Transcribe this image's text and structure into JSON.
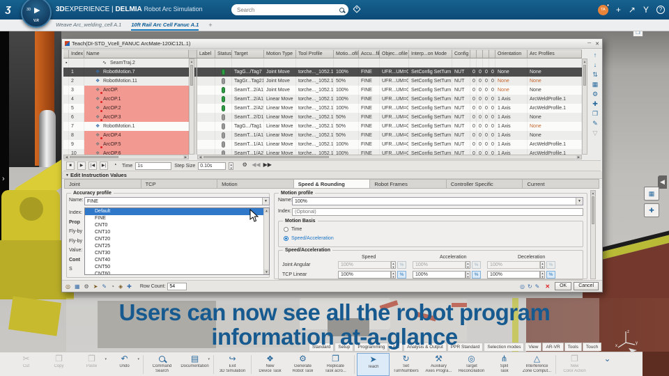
{
  "colors": {
    "topbar": "#0f4d7c",
    "accent_blue": "#1778bc",
    "caption_blue": "#175a8f",
    "selected_row": "#4d4d4d",
    "error_row_bg": "#f29a92",
    "warn_text": "#c4652c",
    "status_green": "#2f9e44",
    "status_gray": "#9a9a9a",
    "brown_floor": "#74392c",
    "robot_yellow": "#cfc12c"
  },
  "topbar": {
    "logo": "3S",
    "brand_3d": "3D",
    "brand_experience": "EXPERIENCE",
    "brand_divider": "|",
    "brand_app": "DELMIA",
    "brand_suffix": "Robot Arc Simulation",
    "compass": {
      "play": "▶",
      "label_3d": "3D",
      "version": "V.R"
    },
    "search_placeholder": "Search",
    "icons": {
      "avatar_initials": "TA",
      "add": "+",
      "share": "↗",
      "collab": "Y",
      "help": "?"
    }
  },
  "window_tabs": {
    "items": [
      {
        "label": "Weave Arc_welding_cell A.1",
        "active": false
      },
      {
        "label": "10ft Rail Arc Cell Fanuc A.1",
        "active": true
      }
    ],
    "add_label": "+"
  },
  "dialog": {
    "title": "Teach(DI-STD_Vcell_FANUC ArcMate-120iC12L.1)",
    "window_icons": [
      {
        "name": "float-icon",
        "glyph": "─"
      },
      {
        "name": "close-icon",
        "glyph": "✕"
      }
    ],
    "table": {
      "headers": {
        "marker": "",
        "index": "Index",
        "name": "Name",
        "gap": "",
        "label": "Label",
        "status": "Status",
        "target": "Target",
        "motion": "Motion Type",
        "tool": "Tool Profile",
        "profile": "Motio...ofile",
        "accuracy": "Accu...file",
        "object": "Objec...ofile",
        "interp": "Interp...on Mode",
        "config": "Config",
        "z0": "",
        "z1": "",
        "z2": "",
        "z3": "",
        "orientation": "Orientation",
        "arc": "Arc Profiles"
      },
      "rows": [
        {
          "kind": "traj",
          "marker": "▪",
          "index": "",
          "name": "SeamTraj.2",
          "status": "",
          "target": "",
          "motion": "",
          "tool": "",
          "profile": "",
          "accuracy": "",
          "object": "",
          "interp": "",
          "config": "",
          "zeros": [
            "",
            "",
            "",
            ""
          ],
          "orientation": "",
          "arc": ""
        },
        {
          "kind": "robot",
          "index": "1",
          "name": "RobotMotion.7",
          "selected": true,
          "status": "green",
          "target": "TagG.../Tag7",
          "motion": "Joint Move",
          "tool": "torche..._1052.1",
          "profile": "100%",
          "accuracy": "FINE",
          "object": "UFR...UM=0",
          "interp": "SetConfig SetTurn",
          "config": "NUT",
          "zeros": [
            "0",
            "0",
            "0",
            "0"
          ],
          "orientation": "None",
          "arc": "None"
        },
        {
          "kind": "robot",
          "index": "2",
          "name": "RobotMotion.11",
          "status": "gray",
          "target": "TagGr...Tag21",
          "motion": "Joint Move",
          "tool": "torche..._1052.1",
          "profile": "50%",
          "accuracy": "FINE",
          "object": "UFR...UM=0",
          "interp": "SetConfig SetTurn",
          "config": "NUT",
          "zeros": [
            "0",
            "0",
            "0",
            "0"
          ],
          "orientation": "None",
          "arc": "None",
          "orientation_warn": true,
          "arc_warn": true
        },
        {
          "kind": "arc",
          "index": "3",
          "name": "ArcOP.",
          "red": true,
          "status": "green",
          "target": "SeamT...2/A1",
          "motion": "Joint Move",
          "tool": "torche..._1052.1",
          "profile": "100%",
          "accuracy": "FINE",
          "object": "UFR...UM=0",
          "interp": "SetConfig SetTurn",
          "config": "NUT",
          "zeros": [
            "0",
            "0",
            "0",
            "0"
          ],
          "orientation": "None",
          "arc": "None",
          "orientation_warn": true
        },
        {
          "kind": "arc",
          "index": "4",
          "name": "ArcOP.1",
          "red": true,
          "status": "green",
          "target": "SeamT...2/A1",
          "motion": "Linear Move",
          "tool": "torche..._1052.1",
          "profile": "100%",
          "accuracy": "FINE",
          "object": "UFR...UM=0",
          "interp": "SetConfig SetTurn",
          "config": "NUT",
          "zeros": [
            "0",
            "0",
            "0",
            "0"
          ],
          "orientation": "1 Axis",
          "arc": "ArcWeldProfile.1"
        },
        {
          "kind": "arc",
          "index": "5",
          "name": "ArcOP.2",
          "red": true,
          "status": "green",
          "target": "SeamT...2/A2",
          "motion": "Linear Move",
          "tool": "torche..._1052.1",
          "profile": "100%",
          "accuracy": "FINE",
          "object": "UFR...UM=0",
          "interp": "SetConfig SetTurn",
          "config": "NUT",
          "zeros": [
            "0",
            "0",
            "0",
            "0"
          ],
          "orientation": "1 Axis",
          "arc": "ArcWeldProfile.1"
        },
        {
          "kind": "arc",
          "index": "6",
          "name": "ArcOP.3",
          "red": true,
          "status": "gray",
          "target": "SeamT...2/D1",
          "motion": "Linear Move",
          "tool": "torche..._1052.1",
          "profile": "50%",
          "accuracy": "FINE",
          "object": "UFR...UM=0",
          "interp": "SetConfig SetTurn",
          "config": "NUT",
          "zeros": [
            "0",
            "0",
            "0",
            "0"
          ],
          "orientation": "1 Axis",
          "arc": "None"
        },
        {
          "kind": "robot",
          "index": "7",
          "name": "RobotMotion.1",
          "status": "gray",
          "target": "TagG.../Tag1",
          "motion": "Linear Move",
          "tool": "torche..._1052.1",
          "profile": "50%",
          "accuracy": "FINE",
          "object": "UFR...UM=0",
          "interp": "SetConfig SetTurn",
          "config": "NUT",
          "zeros": [
            "0",
            "0",
            "0",
            "0"
          ],
          "orientation": "1 Axis",
          "arc": "None",
          "arc_warn": true
        },
        {
          "kind": "arc",
          "index": "8",
          "name": "ArcOP.4",
          "red": true,
          "status": "gray",
          "target": "SeamT...1/A1",
          "motion": "Linear Move",
          "tool": "torche..._1052.1",
          "profile": "50%",
          "accuracy": "FINE",
          "object": "UFR...UM=0",
          "interp": "SetConfig SetTurn",
          "config": "NUT",
          "zeros": [
            "0",
            "0",
            "0",
            "0"
          ],
          "orientation": "1 Axis",
          "arc": "None"
        },
        {
          "kind": "arc",
          "index": "9",
          "name": "ArcOP.5",
          "red": true,
          "status": "gray",
          "target": "SeamT...1/A1",
          "motion": "Linear Move",
          "tool": "torche..._1052.1",
          "profile": "100%",
          "accuracy": "FINE",
          "object": "UFR...UM=0",
          "interp": "SetConfig SetTurn",
          "config": "NUT",
          "zeros": [
            "0",
            "0",
            "0",
            "0"
          ],
          "orientation": "1 Axis",
          "arc": "ArcWeldProfile.1"
        },
        {
          "kind": "arc",
          "index": "10",
          "name": "ArcOP.6",
          "red": true,
          "status": "gray",
          "target": "SeamT...1/A2",
          "motion": "Linear Move",
          "tool": "torche..._1052.1",
          "profile": "100%",
          "accuracy": "FINE",
          "object": "UFR...UM=0",
          "interp": "SetConfig SetTurn",
          "config": "NUT",
          "zeros": [
            "0",
            "0",
            "0",
            "0"
          ],
          "orientation": "1 Axis",
          "arc": "ArcWeldProfile.1"
        }
      ]
    },
    "side_icons": [
      {
        "name": "move-row-up-icon",
        "glyph": "↑"
      },
      {
        "name": "move-row-down-icon",
        "glyph": "↓"
      },
      {
        "name": "swap-rows-icon",
        "glyph": "⇅"
      },
      {
        "name": "table-view-icon",
        "glyph": "▦"
      },
      {
        "name": "settings-icon",
        "glyph": "⚙"
      },
      {
        "name": "add-instruction-icon",
        "glyph": "✚"
      },
      {
        "name": "copy-row-icon",
        "glyph": "❐"
      },
      {
        "name": "edit-row-icon",
        "glyph": "✎"
      },
      {
        "name": "filter-icon",
        "glyph": "▽",
        "dim": true
      }
    ],
    "playback": {
      "buttons": [
        {
          "name": "stop-button",
          "glyph": "■"
        },
        {
          "name": "play-button",
          "glyph": "▶"
        },
        {
          "name": "skip-back-button",
          "glyph": "|◀"
        },
        {
          "name": "skip-forward-button",
          "glyph": "▶|"
        }
      ],
      "clock_icon": "◔",
      "time_label": "Time",
      "time_value": "1s",
      "step_label": "Step Size",
      "step_value": "0.10s",
      "gear_icon": "⚙",
      "rewind": "◀◀",
      "forward": "▶▶"
    },
    "edit_section": {
      "collapse_arrow": "▼",
      "title": "Edit Instruction Values",
      "tabs": [
        "Joint",
        "TCP",
        "Motion",
        "Speed & Rounding",
        "Robot Frames",
        "Controller Specific",
        "Current"
      ],
      "active_tab": "Speed & Rounding"
    },
    "accuracy_profile": {
      "title": "Accuracy profile",
      "name_label": "Name:",
      "name_value": "FINE",
      "hidden_fragments": [
        "Index:",
        "Prop",
        "Fly-by",
        "Fly-by",
        "Value:",
        "Cont",
        "S"
      ],
      "dropdown": {
        "options": [
          "Default",
          "FINE",
          "CNT0",
          "CNT10",
          "CNT20",
          "CNT25",
          "CNT30",
          "CNT40",
          "CNT50",
          "CNT60"
        ],
        "selected": "Default"
      }
    },
    "motion_profile": {
      "title": "Motion profile",
      "name_label": "Name:",
      "name_value": "100%",
      "index_label": "Index:",
      "index_placeholder": "(Optional)",
      "motion_basis": {
        "title": "Motion Basis",
        "options": [
          {
            "label": "Time",
            "selected": false
          },
          {
            "label": "Speed/Acceleration",
            "selected": true
          }
        ]
      },
      "speed_accel": {
        "title": "Speed/Acceleration",
        "col_headers": [
          "Speed",
          "Acceleration",
          "Deceleration"
        ],
        "percent": "%",
        "rows": [
          {
            "label": "Joint Angular",
            "values": [
              "100%",
              "100%",
              "100%"
            ],
            "disabled": true
          },
          {
            "label": "TCP Linear",
            "values": [
              "100%",
              "100%",
              "100%"
            ],
            "disabled": false
          }
        ]
      }
    },
    "footer": {
      "left_icons": [
        {
          "name": "jog-icon",
          "glyph": "◎"
        },
        {
          "name": "grid-icon",
          "glyph": "▦"
        },
        {
          "name": "gear-icon",
          "glyph": "⚙"
        },
        {
          "name": "run-icon",
          "glyph": "➤"
        },
        {
          "name": "edit-icon",
          "glyph": "✎"
        },
        {
          "name": "time-icon",
          "glyph": "◔"
        },
        {
          "name": "frame-icon",
          "glyph": "◈"
        },
        {
          "name": "add-icon",
          "glyph": "✚"
        }
      ],
      "row_count_label": "Row Count:",
      "row_count_value": "54",
      "right_icons": [
        {
          "name": "robot-icon",
          "glyph": "◎"
        },
        {
          "name": "refresh-icon",
          "glyph": "↻"
        },
        {
          "name": "teach-pendant-icon",
          "glyph": "✎"
        }
      ],
      "close_x": "✕",
      "ok": "OK",
      "cancel": "Cancel"
    }
  },
  "caption": {
    "line1": "Users can now see all the robot program",
    "line2": "information at-a-glance"
  },
  "ribbon_tabs": [
    "Standard",
    "Setup",
    "Programming",
    "Arc",
    "Analysis & Output",
    "PPR Standard",
    "Selection modes",
    "View",
    "AR-VR",
    "Tools",
    "Touch"
  ],
  "toolbar": {
    "items": [
      {
        "name": "cut-button",
        "icon": "✂",
        "lines": [
          "Cut"
        ],
        "state": "disabled"
      },
      {
        "name": "copy-button",
        "icon": "❐",
        "lines": [
          "Copy"
        ],
        "state": "disabled"
      },
      {
        "name": "paste-button",
        "icon": "❒",
        "lines": [
          "Paste"
        ],
        "state": "disabled",
        "caret": true
      },
      {
        "name": "undo-button",
        "icon": "↶",
        "lines": [
          "Undo"
        ],
        "state": "normal",
        "caret": true
      },
      {
        "sep": true
      },
      {
        "name": "command-search-button",
        "icon": "mag",
        "lines": [
          "Command",
          "Search"
        ],
        "state": "normal"
      },
      {
        "name": "documentation-button",
        "icon": "▤",
        "lines": [
          "Documentation"
        ],
        "state": "normal",
        "caret": true
      },
      {
        "sep": true
      },
      {
        "name": "exit-3d-simulation-button",
        "icon": "↪",
        "lines": [
          "Exit",
          "3D Simulation"
        ],
        "state": "normal"
      },
      {
        "sep": true
      },
      {
        "name": "new-device-task-button",
        "icon": "❖",
        "lines": [
          "New",
          "Device Task"
        ],
        "state": "normal"
      },
      {
        "name": "generate-robot-task-button",
        "icon": "⚙",
        "lines": [
          "Generate",
          "Robot Task"
        ],
        "state": "normal"
      },
      {
        "name": "replicate-task-button",
        "icon": "❐",
        "lines": [
          "Replicate",
          "Task acro..."
        ],
        "state": "normal"
      },
      {
        "sep": true
      },
      {
        "name": "teach-button",
        "icon": "➤",
        "lines": [
          "Teach"
        ],
        "state": "active"
      },
      {
        "name": "set-turnnumbers-button",
        "icon": "↻",
        "lines": [
          "Set",
          "TurnNumbers"
        ],
        "state": "normal"
      },
      {
        "name": "auxiliary-axes-button",
        "icon": "⚒",
        "lines": [
          "Auxiliary",
          "Axes Progra..."
        ],
        "state": "normal"
      },
      {
        "name": "target-reconciliation-button",
        "icon": "◎",
        "lines": [
          "Target",
          "Reconciliation"
        ],
        "state": "normal"
      },
      {
        "name": "split-task-button",
        "icon": "⋔",
        "lines": [
          "Split",
          "Task"
        ],
        "state": "normal"
      },
      {
        "name": "interference-zone-button",
        "icon": "△",
        "lines": [
          "Interference",
          "Zone Comput..."
        ],
        "state": "normal"
      },
      {
        "sep": true
      },
      {
        "name": "new-color-action-button",
        "icon": "❒",
        "lines": [
          "New",
          "Color Action"
        ],
        "state": "disabled"
      },
      {
        "name": "toolbar-overflow-button",
        "icon": "⌄",
        "lines": [
          ""
        ],
        "state": "normal"
      }
    ]
  },
  "viewport": {
    "left_chevron": "›",
    "right_chevron": "◀",
    "mini_buttons": [
      {
        "name": "viewport-grid-button",
        "glyph": "▦"
      },
      {
        "name": "viewport-pan-button",
        "glyph": "✚"
      }
    ],
    "restore_glyph": "❐",
    "axis_labels": {
      "z": "z",
      "x": "x",
      "y": "y"
    }
  }
}
